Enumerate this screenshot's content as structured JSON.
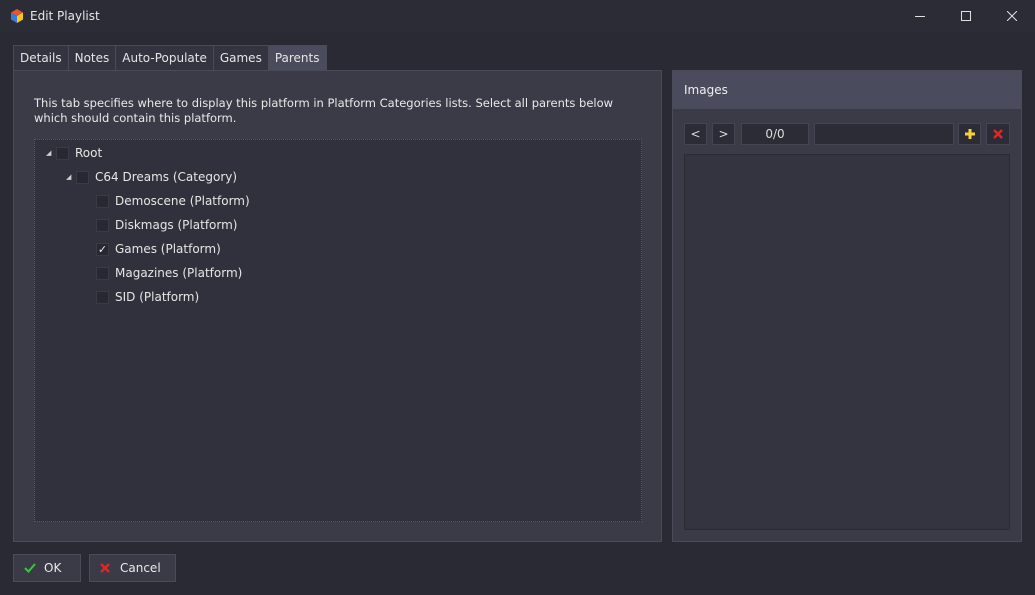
{
  "window": {
    "title": "Edit Playlist"
  },
  "tabs": [
    {
      "label": "Details"
    },
    {
      "label": "Notes"
    },
    {
      "label": "Auto-Populate"
    },
    {
      "label": "Games"
    },
    {
      "label": "Parents",
      "active": true
    }
  ],
  "parents": {
    "description": "This tab specifies where to display this platform in Platform Categories lists. Select all parents below which should contain this platform.",
    "tree": [
      {
        "label": "Root",
        "checked": false,
        "expanded": true
      },
      {
        "label": "C64 Dreams (Category)",
        "checked": false,
        "expanded": true
      },
      {
        "label": "Demoscene (Platform)",
        "checked": false
      },
      {
        "label": "Diskmags (Platform)",
        "checked": false
      },
      {
        "label": "Games (Platform)",
        "checked": true
      },
      {
        "label": "Magazines (Platform)",
        "checked": false
      },
      {
        "label": "SID (Platform)",
        "checked": false
      }
    ]
  },
  "images": {
    "title": "Images",
    "prev_label": "<",
    "next_label": ">",
    "counter": "0/0",
    "name_value": ""
  },
  "footer": {
    "ok_label": "OK",
    "cancel_label": "Cancel"
  },
  "colors": {
    "window_bg": "#292a33",
    "panel_bg": "#3a3b47",
    "ok_green": "#3cc33c",
    "cancel_red": "#e0262b",
    "add_yellow": "#f3d23a"
  },
  "icons": {
    "ok": "check-icon",
    "cancel": "x-icon",
    "add": "plus-icon",
    "remove": "remove-icon"
  }
}
